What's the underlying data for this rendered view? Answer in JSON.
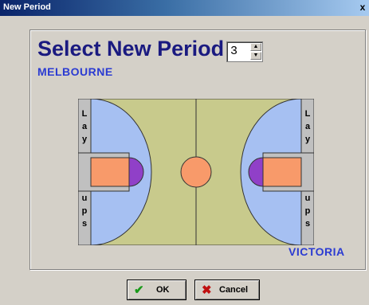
{
  "window": {
    "title": "New Period",
    "close_glyph": "x"
  },
  "dialog": {
    "heading": "Select New Period",
    "period_value": "3",
    "team_home": "MELBOURNE",
    "team_away": "VICTORIA"
  },
  "court": {
    "side_labels_top": [
      "L",
      "a",
      "y"
    ],
    "side_labels_bottom": [
      "u",
      "p",
      "s"
    ],
    "colors": {
      "floor": "#c8ca8c",
      "key": "#f89a6a",
      "arc": "#a6c0f2",
      "circle": "#9040c8",
      "side": "#c0c0c0"
    }
  },
  "buttons": {
    "ok": "OK",
    "cancel": "Cancel",
    "ok_icon": "checkmark-icon",
    "cancel_icon": "x-icon"
  }
}
